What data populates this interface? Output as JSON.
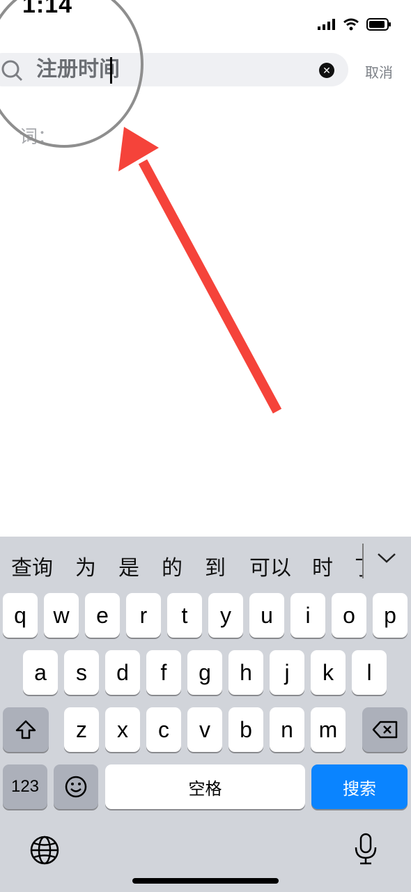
{
  "status_bar": {
    "time": "1:14"
  },
  "search": {
    "query": "注册时间",
    "cancel_label": "取消"
  },
  "history_label": "词：",
  "keyboard": {
    "candidates": [
      "查询",
      "为",
      "是",
      "的",
      "到",
      "可以",
      "时",
      "了"
    ],
    "rows": [
      [
        "q",
        "w",
        "e",
        "r",
        "t",
        "y",
        "u",
        "i",
        "o",
        "p"
      ],
      [
        "a",
        "s",
        "d",
        "f",
        "g",
        "h",
        "j",
        "k",
        "l"
      ],
      [
        "z",
        "x",
        "c",
        "v",
        "b",
        "n",
        "m"
      ]
    ],
    "numbers_label": "123",
    "space_label": "空格",
    "search_label": "搜索"
  },
  "colors": {
    "accent": "#0a84ff",
    "annotation_arrow": "#f5433a"
  }
}
